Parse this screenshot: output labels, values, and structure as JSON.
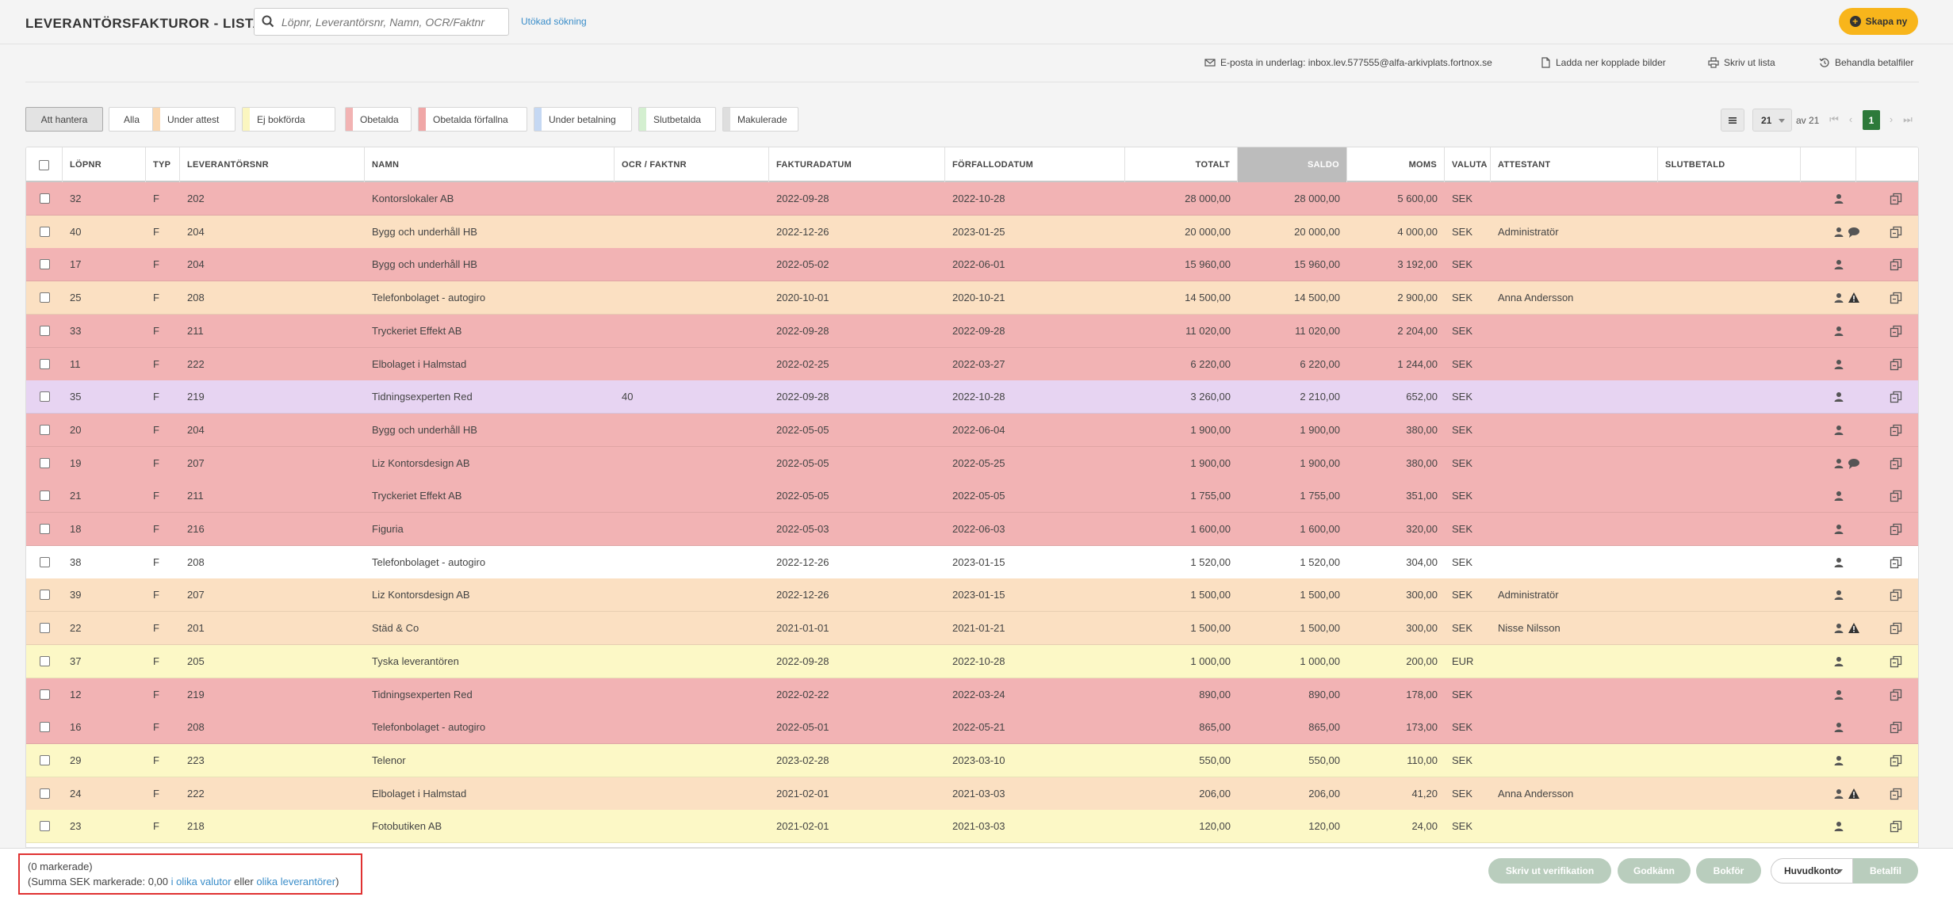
{
  "header": {
    "title": "LEVERANTÖRSFAKTUROR - LISTA",
    "search_placeholder": "Löpnr, Leverantörsnr, Namn, OCR/Faktnr",
    "advanced_search": "Utökad sökning",
    "create_label": "Skapa ny"
  },
  "actions": {
    "email": "E-posta in underlag: inbox.lev.577555@alfa-arkivplats.fortnox.se",
    "download": "Ladda ner kopplade bilder",
    "print": "Skriv ut lista",
    "process": "Behandla betalfiler"
  },
  "filters": [
    {
      "label": "Att hantera",
      "color": "",
      "active": true
    },
    {
      "label": "Alla",
      "color": ""
    },
    {
      "label": "Under attest",
      "color": "#fad7b0"
    },
    {
      "label": "Ej bokförda",
      "color": "#fbf6c0"
    },
    {
      "label": "Obetalda",
      "color": "#f2b3b3"
    },
    {
      "label": "Obetalda förfallna",
      "color": "#f0a7a7"
    },
    {
      "label": "Under betalning",
      "color": "#c5d8f3"
    },
    {
      "label": "Slutbetalda",
      "color": "#d4efd0"
    },
    {
      "label": "Makulerade",
      "color": "#dedede"
    }
  ],
  "pagination": {
    "per_page": "21",
    "of_label": "av 21",
    "current_page": "1"
  },
  "columns": [
    "LÖPNR",
    "TYP",
    "LEVERANTÖRSNR",
    "NAMN",
    "OCR / FAKTNR",
    "FAKTURADATUM",
    "FÖRFALLODATUM",
    "TOTALT",
    "SALDO",
    "MOMS",
    "VALUTA",
    "ATTESTANT",
    "SLUTBETALD"
  ],
  "colors": {
    "red": "#f2b3b4",
    "orange": "#fbe0c2",
    "purple": "#e7d4f2",
    "white": "#ffffff",
    "yellow": "#fcf8c6"
  },
  "rows": [
    {
      "lopnr": "32",
      "typ": "F",
      "levnr": "202",
      "namn": "Kontorslokaler AB",
      "ocr": "",
      "fdatum": "2022-09-28",
      "forfall": "2022-10-28",
      "totalt": "28 000,00",
      "saldo": "28 000,00",
      "moms": "5 600,00",
      "valuta": "SEK",
      "attestant": "",
      "color": "red",
      "comment": false,
      "warning": false
    },
    {
      "lopnr": "40",
      "typ": "F",
      "levnr": "204",
      "namn": "Bygg och underhåll HB",
      "ocr": "",
      "fdatum": "2022-12-26",
      "forfall": "2023-01-25",
      "totalt": "20 000,00",
      "saldo": "20 000,00",
      "moms": "4 000,00",
      "valuta": "SEK",
      "attestant": "Administratör",
      "color": "orange",
      "comment": true,
      "warning": false
    },
    {
      "lopnr": "17",
      "typ": "F",
      "levnr": "204",
      "namn": "Bygg och underhåll HB",
      "ocr": "",
      "fdatum": "2022-05-02",
      "forfall": "2022-06-01",
      "totalt": "15 960,00",
      "saldo": "15 960,00",
      "moms": "3 192,00",
      "valuta": "SEK",
      "attestant": "",
      "color": "red",
      "comment": false,
      "warning": false
    },
    {
      "lopnr": "25",
      "typ": "F",
      "levnr": "208",
      "namn": "Telefonbolaget - autogiro",
      "ocr": "",
      "fdatum": "2020-10-01",
      "forfall": "2020-10-21",
      "totalt": "14 500,00",
      "saldo": "14 500,00",
      "moms": "2 900,00",
      "valuta": "SEK",
      "attestant": "Anna Andersson",
      "color": "orange",
      "comment": false,
      "warning": true
    },
    {
      "lopnr": "33",
      "typ": "F",
      "levnr": "211",
      "namn": "Tryckeriet Effekt AB",
      "ocr": "",
      "fdatum": "2022-09-28",
      "forfall": "2022-09-28",
      "totalt": "11 020,00",
      "saldo": "11 020,00",
      "moms": "2 204,00",
      "valuta": "SEK",
      "attestant": "",
      "color": "red",
      "comment": false,
      "warning": false
    },
    {
      "lopnr": "11",
      "typ": "F",
      "levnr": "222",
      "namn": "Elbolaget i Halmstad",
      "ocr": "",
      "fdatum": "2022-02-25",
      "forfall": "2022-03-27",
      "totalt": "6 220,00",
      "saldo": "6 220,00",
      "moms": "1 244,00",
      "valuta": "SEK",
      "attestant": "",
      "color": "red",
      "comment": false,
      "warning": false
    },
    {
      "lopnr": "35",
      "typ": "F",
      "levnr": "219",
      "namn": "Tidningsexperten Red",
      "ocr": "40",
      "fdatum": "2022-09-28",
      "forfall": "2022-10-28",
      "totalt": "3 260,00",
      "saldo": "2 210,00",
      "moms": "652,00",
      "valuta": "SEK",
      "attestant": "",
      "color": "purple",
      "comment": false,
      "warning": false
    },
    {
      "lopnr": "20",
      "typ": "F",
      "levnr": "204",
      "namn": "Bygg och underhåll HB",
      "ocr": "",
      "fdatum": "2022-05-05",
      "forfall": "2022-06-04",
      "totalt": "1 900,00",
      "saldo": "1 900,00",
      "moms": "380,00",
      "valuta": "SEK",
      "attestant": "",
      "color": "red",
      "comment": false,
      "warning": false
    },
    {
      "lopnr": "19",
      "typ": "F",
      "levnr": "207",
      "namn": "Liz Kontorsdesign AB",
      "ocr": "",
      "fdatum": "2022-05-05",
      "forfall": "2022-05-25",
      "totalt": "1 900,00",
      "saldo": "1 900,00",
      "moms": "380,00",
      "valuta": "SEK",
      "attestant": "",
      "color": "red",
      "comment": true,
      "warning": false
    },
    {
      "lopnr": "21",
      "typ": "F",
      "levnr": "211",
      "namn": "Tryckeriet Effekt AB",
      "ocr": "",
      "fdatum": "2022-05-05",
      "forfall": "2022-05-05",
      "totalt": "1 755,00",
      "saldo": "1 755,00",
      "moms": "351,00",
      "valuta": "SEK",
      "attestant": "",
      "color": "red",
      "comment": false,
      "warning": false
    },
    {
      "lopnr": "18",
      "typ": "F",
      "levnr": "216",
      "namn": "Figuria",
      "ocr": "",
      "fdatum": "2022-05-03",
      "forfall": "2022-06-03",
      "totalt": "1 600,00",
      "saldo": "1 600,00",
      "moms": "320,00",
      "valuta": "SEK",
      "attestant": "",
      "color": "red",
      "comment": false,
      "warning": false
    },
    {
      "lopnr": "38",
      "typ": "F",
      "levnr": "208",
      "namn": "Telefonbolaget - autogiro",
      "ocr": "",
      "fdatum": "2022-12-26",
      "forfall": "2023-01-15",
      "totalt": "1 520,00",
      "saldo": "1 520,00",
      "moms": "304,00",
      "valuta": "SEK",
      "attestant": "",
      "color": "white",
      "comment": false,
      "warning": false
    },
    {
      "lopnr": "39",
      "typ": "F",
      "levnr": "207",
      "namn": "Liz Kontorsdesign AB",
      "ocr": "",
      "fdatum": "2022-12-26",
      "forfall": "2023-01-15",
      "totalt": "1 500,00",
      "saldo": "1 500,00",
      "moms": "300,00",
      "valuta": "SEK",
      "attestant": "Administratör",
      "color": "orange",
      "comment": false,
      "warning": false
    },
    {
      "lopnr": "22",
      "typ": "F",
      "levnr": "201",
      "namn": "Städ & Co",
      "ocr": "",
      "fdatum": "2021-01-01",
      "forfall": "2021-01-21",
      "totalt": "1 500,00",
      "saldo": "1 500,00",
      "moms": "300,00",
      "valuta": "SEK",
      "attestant": "Nisse Nilsson",
      "color": "orange",
      "comment": false,
      "warning": true
    },
    {
      "lopnr": "37",
      "typ": "F",
      "levnr": "205",
      "namn": "Tyska leverantören",
      "ocr": "",
      "fdatum": "2022-09-28",
      "forfall": "2022-10-28",
      "totalt": "1 000,00",
      "saldo": "1 000,00",
      "moms": "200,00",
      "valuta": "EUR",
      "attestant": "",
      "color": "yellow",
      "comment": false,
      "warning": false
    },
    {
      "lopnr": "12",
      "typ": "F",
      "levnr": "219",
      "namn": "Tidningsexperten Red",
      "ocr": "",
      "fdatum": "2022-02-22",
      "forfall": "2022-03-24",
      "totalt": "890,00",
      "saldo": "890,00",
      "moms": "178,00",
      "valuta": "SEK",
      "attestant": "",
      "color": "red",
      "comment": false,
      "warning": false
    },
    {
      "lopnr": "16",
      "typ": "F",
      "levnr": "208",
      "namn": "Telefonbolaget - autogiro",
      "ocr": "",
      "fdatum": "2022-05-01",
      "forfall": "2022-05-21",
      "totalt": "865,00",
      "saldo": "865,00",
      "moms": "173,00",
      "valuta": "SEK",
      "attestant": "",
      "color": "red",
      "comment": false,
      "warning": false
    },
    {
      "lopnr": "29",
      "typ": "F",
      "levnr": "223",
      "namn": "Telenor",
      "ocr": "",
      "fdatum": "2023-02-28",
      "forfall": "2023-03-10",
      "totalt": "550,00",
      "saldo": "550,00",
      "moms": "110,00",
      "valuta": "SEK",
      "attestant": "",
      "color": "yellow",
      "comment": false,
      "warning": false
    },
    {
      "lopnr": "24",
      "typ": "F",
      "levnr": "222",
      "namn": "Elbolaget i Halmstad",
      "ocr": "",
      "fdatum": "2021-02-01",
      "forfall": "2021-03-03",
      "totalt": "206,00",
      "saldo": "206,00",
      "moms": "41,20",
      "valuta": "SEK",
      "attestant": "Anna Andersson",
      "color": "orange",
      "comment": false,
      "warning": true
    },
    {
      "lopnr": "23",
      "typ": "F",
      "levnr": "218",
      "namn": "Fotobutiken AB",
      "ocr": "",
      "fdatum": "2021-02-01",
      "forfall": "2021-03-03",
      "totalt": "120,00",
      "saldo": "120,00",
      "moms": "24,00",
      "valuta": "SEK",
      "attestant": "",
      "color": "yellow",
      "comment": false,
      "warning": false
    }
  ],
  "footer": {
    "selected": "(0 markerade)",
    "sum_prefix": "(Summa SEK markerade: 0,00",
    "currencies_link": "i olika valutor",
    "or_text": "eller",
    "suppliers_link": "olika leverantörer",
    "sum_suffix": ")",
    "print_verification": "Skriv ut verifikation",
    "approve": "Godkänn",
    "book": "Bokför",
    "account": "Huvudkonto",
    "payment_file": "Betalfil"
  }
}
